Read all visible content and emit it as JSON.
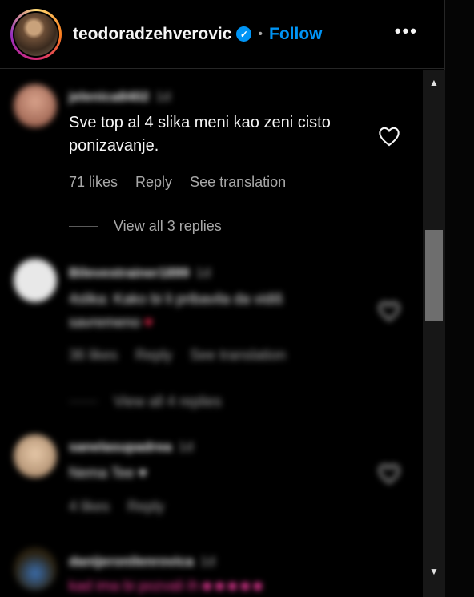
{
  "header": {
    "username": "teodoradzehverovic",
    "verified_mark": "✓",
    "separator": "•",
    "follow_label": "Follow",
    "more_label": "•••"
  },
  "comments": [
    {
      "username": "jelenica8402",
      "time": "1d",
      "text": "Sve top al 4 slika meni kao zeni cisto ponizavanje.",
      "likes": "71 likes",
      "reply": "Reply",
      "translation": "See translation",
      "view_replies": "View all 3 replies"
    },
    {
      "username": "Bilevestrainer1899",
      "time": "1d",
      "text": "4slika: Kako bi li pribavila da vidiš savremeno",
      "emoji": "♥",
      "likes": "36 likes",
      "reply": "Reply",
      "translation": "See translation",
      "view_replies": "View all 4 replies"
    },
    {
      "username": "sanelasupadrea",
      "time": "1d",
      "text": "Nema Tee",
      "emoji": "♥",
      "likes": "4 likes",
      "reply": "Reply"
    },
    {
      "username": "danijeronilenrovica",
      "time": "1d",
      "text": "kad ima bi pozvali ih ■ ■ ■ ■ ■"
    }
  ],
  "icons": {
    "heart": "heart-outline-icon",
    "scroll_up": "▲",
    "scroll_down": "▼"
  },
  "colors": {
    "accent": "#0095f6",
    "background": "#000000",
    "secondary_text": "#a8a8a8"
  }
}
